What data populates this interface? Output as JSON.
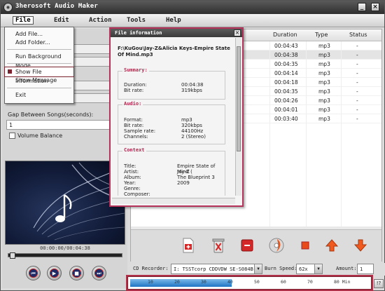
{
  "app": {
    "title": "3herosoft Audio Maker"
  },
  "menu": {
    "file": "File",
    "edit": "Edit",
    "action": "Action",
    "tools": "Tools",
    "help": "Help"
  },
  "file_menu": {
    "items": [
      "Add File...",
      "Add Folder...",
      "Run Background Mode",
      "Show File Information",
      "Show Message",
      "Exit"
    ],
    "highlighted": "Show File Information"
  },
  "left_panel": {
    "gap_label": "Gap Between Songs(seconds):",
    "gap_value": "1",
    "volume_balance": "Volume Balance"
  },
  "player": {
    "time": "00:00:00/00:04:38",
    "buttons": [
      "previous",
      "play",
      "stop",
      "next"
    ]
  },
  "file_list": {
    "columns": [
      "Duration",
      "Type",
      "Status"
    ],
    "rows": [
      {
        "duration": "00:04:43",
        "type": "mp3",
        "status": "-"
      },
      {
        "duration": "00:04:38",
        "type": "mp3",
        "status": "-"
      },
      {
        "duration": "00:04:35",
        "type": "mp3",
        "status": "-"
      },
      {
        "duration": "00:04:14",
        "type": "mp3",
        "status": "-"
      },
      {
        "duration": "00:04:18",
        "type": "mp3",
        "status": "-"
      },
      {
        "duration": "00:04:35",
        "type": "mp3",
        "status": "-"
      },
      {
        "duration": "00:04:26",
        "type": "mp3",
        "status": "-"
      },
      {
        "duration": "00:04:01",
        "type": "mp3",
        "status": "-"
      },
      {
        "duration": "00:03:40",
        "type": "mp3",
        "status": "-"
      }
    ],
    "selected_index": 1
  },
  "toolbar": {
    "icons": [
      "add-file-icon",
      "delete-icon",
      "remove-icon",
      "burn-disc-icon",
      "clear-icon",
      "move-up-icon",
      "move-down-icon"
    ]
  },
  "burn": {
    "cd_recorder_label": "CD Recorder:",
    "cd_recorder_value": "I: TSSTcorp CDDVDW SE-S084B",
    "burn_speed_label": "Burn Speed:",
    "burn_speed_value": "62x",
    "amount_label": "Amount:",
    "amount_value": "1",
    "help": "!?"
  },
  "capacity": {
    "ticks": [
      "10",
      "20",
      "30",
      "40",
      "50",
      "60",
      "70",
      "80 Min"
    ],
    "used_fraction": 0.44
  },
  "file_info": {
    "title": "File information",
    "path": "F:\\KuGou\\Jay-Z&Alicia Keys-Empire State Of Mind.mp3",
    "summary_title": "Summary:",
    "summary": [
      {
        "k": "Duration:",
        "v": "00:04:38"
      },
      {
        "k": "Bit rate:",
        "v": "319kbps"
      }
    ],
    "audio_title": "Audio:",
    "audio": [
      {
        "k": "Format:",
        "v": "mp3"
      },
      {
        "k": "Bit rate:",
        "v": "320kbps"
      },
      {
        "k": "Sample rate:",
        "v": "44100Hz"
      },
      {
        "k": "Channels:",
        "v": "2 (Stereo)"
      }
    ],
    "context_title": "Context",
    "context": [
      {
        "k": "Title:",
        "v": "Empire State of Mind ("
      },
      {
        "k": "Artist:",
        "v": "Jay-Z"
      },
      {
        "k": "Album:",
        "v": "The Blueprint 3"
      },
      {
        "k": "Year:",
        "v": "2009"
      },
      {
        "k": "Genre:",
        "v": ""
      },
      {
        "k": "Composer:",
        "v": ""
      }
    ]
  },
  "colors": {
    "accent": "#b5335a",
    "capacity_fill": "#1e74c4"
  }
}
